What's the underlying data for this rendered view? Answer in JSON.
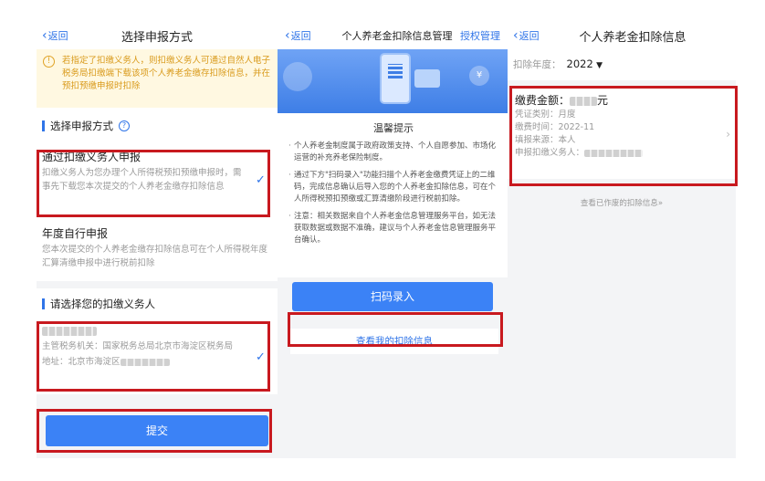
{
  "panel1": {
    "nav": {
      "back_label": "返回",
      "title": "选择申报方式"
    },
    "notice": "若指定了扣缴义务人，则扣缴义务人可通过自然人电子税务局扣缴端下载该项个人养老金缴存扣除信息，并在预扣预缴申报时扣除",
    "section_method": "选择申报方式",
    "option_withholding": {
      "title": "通过扣缴义务人申报",
      "desc": "扣缴义务人为您办理个人所得税预扣预缴申报时，需事先下载您本次提交的个人养老金缴存扣除信息"
    },
    "option_annual": {
      "title": "年度自行申报",
      "desc": "您本次提交的个人养老金缴存扣除信息可在个人所得税年度汇算清缴申报中进行税前扣除"
    },
    "section_agent": "请选择您的扣缴义务人",
    "agent": {
      "tax_office": "主管税务机关：国家税务总局北京市海淀区税务局",
      "address_prefix": "地址：北京市海淀区"
    },
    "submit_label": "提交"
  },
  "panel2": {
    "nav": {
      "back_label": "返回",
      "title": "个人养老金扣除信息管理",
      "action": "授权管理"
    },
    "tips_title": "温馨提示",
    "tips": [
      "个人养老金制度属于政府政策支持、个人自愿参加、市场化运营的补充养老保险制度。",
      "通过下方\"扫码录入\"功能扫描个人养老金缴费凭证上的二维码，完成信息确认后导入您的个人养老金扣除信息，可在个人所得税预扣预缴或汇算清缴阶段进行税前扣除。",
      "注意：相关数据来自个人养老金信息管理服务平台，如无法获取数据或数据不准确，建议与个人养老金信息管理服务平台确认。"
    ],
    "scan_label": "扫码录入",
    "view_label": "查看我的扣除信息"
  },
  "panel3": {
    "nav": {
      "back_label": "返回",
      "title": "个人养老金扣除信息"
    },
    "year_label": "扣除年度：",
    "year_value": "2022",
    "card": {
      "amount_label": "缴费金额：",
      "amount_unit": "元",
      "voucher": "凭证类别：月度",
      "pay_time": "缴费时间：2022-11",
      "source": "填报来源：本人",
      "agent_label": "申报扣缴义务人："
    },
    "more_label": "查看已作废的扣除信息"
  },
  "colors": {
    "accent": "#2f74e8",
    "highlight": "#c8191f",
    "notice_text": "#d99a1b"
  }
}
